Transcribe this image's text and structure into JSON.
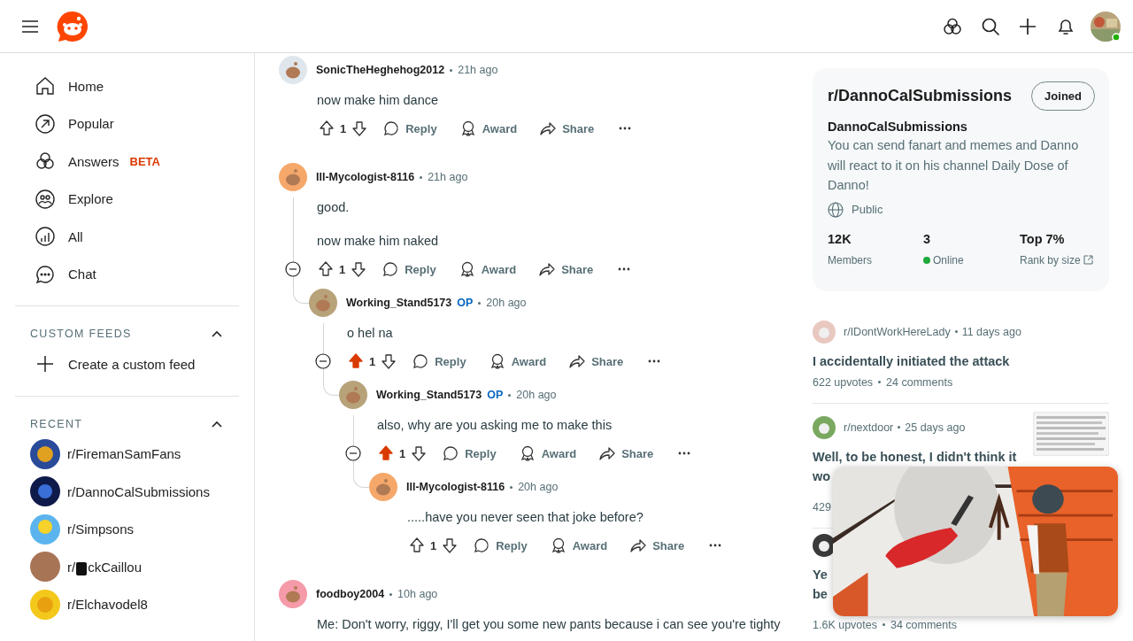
{
  "header": {
    "notifications": true
  },
  "sidebar": {
    "nav": [
      {
        "label": "Home"
      },
      {
        "label": "Popular"
      },
      {
        "label": "Answers",
        "badge": "BETA"
      },
      {
        "label": "Explore"
      },
      {
        "label": "All"
      },
      {
        "label": "Chat"
      }
    ],
    "custom_feeds": {
      "title": "CUSTOM FEEDS",
      "expanded": true,
      "create_label": "Create a custom feed"
    },
    "recent": {
      "title": "RECENT",
      "expanded": true,
      "items": [
        {
          "label": "r/FiremanSamFans",
          "color": "#2a4a9a"
        },
        {
          "label": "r/DannoCalSubmissions",
          "color": "#0e1a4a"
        },
        {
          "label": "r/Simpsons",
          "color": "#5bb4ee"
        },
        {
          "label": "r/",
          "label_after": "ckCaillou",
          "censored": true,
          "color": "#a87456"
        },
        {
          "label": "r/Elchavodel8",
          "color": "#f3c81a"
        }
      ]
    }
  },
  "comments": [
    {
      "user": "SonicTheHeghehog2012",
      "time": "21h ago",
      "color": "#dfe6ec",
      "body": [
        "now make him dance"
      ],
      "votes": "1",
      "upvoted": false,
      "reply": "Reply",
      "award": "Award",
      "share": "Share"
    },
    {
      "user": "Ill-Mycologist-8116",
      "time": "21h ago",
      "color": "#f5a86a",
      "body": [
        "good.",
        "now make him naked"
      ],
      "votes": "1",
      "upvoted": false,
      "reply": "Reply",
      "award": "Award",
      "share": "Share",
      "children": [
        {
          "user": "Working_Stand5173",
          "op_label": "OP",
          "time": "20h ago",
          "color": "#b7a27a",
          "body": [
            "o hel na"
          ],
          "votes": "1",
          "upvoted": true,
          "reply": "Reply",
          "award": "Award",
          "share": "Share",
          "children": [
            {
              "user": "Working_Stand5173",
              "op_label": "OP",
              "time": "20h ago",
              "color": "#b7a27a",
              "body": [
                "also, why are you asking me to make this"
              ],
              "votes": "1",
              "upvoted": true,
              "reply": "Reply",
              "award": "Award",
              "share": "Share",
              "children": [
                {
                  "user": "Ill-Mycologist-8116",
                  "time": "20h ago",
                  "color": "#f5a86a",
                  "body": [
                    ".....have you never seen that joke before?"
                  ],
                  "votes": "1",
                  "upvoted": false,
                  "reply": "Reply",
                  "award": "Award",
                  "share": "Share"
                }
              ]
            }
          ]
        }
      ]
    },
    {
      "user": "foodboy2004",
      "time": "10h ago",
      "color": "#f59aa8",
      "body": [
        "Me: Don't worry, riggy, I'll get you some new pants because i can see you're tighty"
      ]
    }
  ],
  "community": {
    "title": "r/DannoCalSubmissions",
    "button": "Joined",
    "name": "DannoCalSubmissions",
    "description": "You can send fanart and memes and Danno will react to it on his channel Daily Dose of Danno!",
    "visibility": "Public",
    "stats": [
      {
        "value": "12K",
        "label": "Members",
        "kind": "plain"
      },
      {
        "value": "3",
        "label": "Online",
        "kind": "online"
      },
      {
        "value": "Top 7%",
        "label": "Rank by size",
        "kind": "link"
      }
    ]
  },
  "related": [
    {
      "sub": "r/IDontWorkHereLady",
      "time": "11 days ago",
      "color": "#e8c8c0",
      "title_lines": [
        "I accidentally initiated the attack"
      ],
      "upvotes": "622 upvotes",
      "comments": "24 comments"
    },
    {
      "sub": "r/nextdoor",
      "time": "25 days ago",
      "color": "#7aa860",
      "title_lines": [
        "Well, to be honest, I didn't think it",
        "wo"
      ],
      "upvotes": "429",
      "thumbnail": true
    },
    {
      "color": "#3a3a3a",
      "title_lines": [
        "Ye",
        "be"
      ],
      "upvotes": "1.6K upvotes",
      "comments": "34 comments"
    }
  ]
}
